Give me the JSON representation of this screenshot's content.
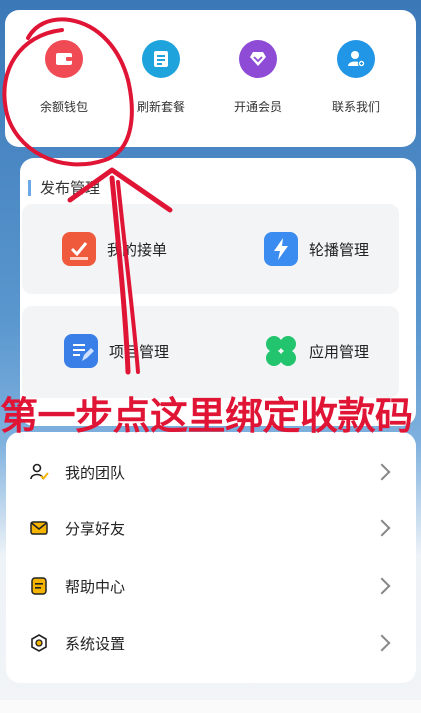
{
  "quick_actions": [
    {
      "label": "余额钱包",
      "icon": "wallet-icon",
      "color": "#f04b55"
    },
    {
      "label": "刷新套餐",
      "icon": "refresh-package-icon",
      "color": "#1fa3dc"
    },
    {
      "label": "开通会员",
      "icon": "vip-diamond-icon",
      "color": "#8d4bd6"
    },
    {
      "label": "联系我们",
      "icon": "contact-user-icon",
      "color": "#2196e6"
    }
  ],
  "publish": {
    "title": "发布管理",
    "items": [
      {
        "label": "我的接单",
        "icon": "orders-icon",
        "color": "#f05a3c"
      },
      {
        "label": "轮播管理",
        "icon": "carousel-bolt-icon",
        "color": "#3a8cf0"
      },
      {
        "label": "项目管理",
        "icon": "project-edit-icon",
        "color": "#3a7ee8"
      },
      {
        "label": "应用管理",
        "icon": "apps-clover-icon",
        "color": "#22c46e"
      }
    ]
  },
  "menu": [
    {
      "label": "我的团队",
      "icon": "team-icon"
    },
    {
      "label": "分享好友",
      "icon": "share-mail-icon"
    },
    {
      "label": "帮助中心",
      "icon": "help-doc-icon"
    },
    {
      "label": "系统设置",
      "icon": "settings-hex-icon"
    }
  ],
  "annotation": {
    "text": "第一步点这里绑定收款码",
    "color": "#e01535"
  }
}
